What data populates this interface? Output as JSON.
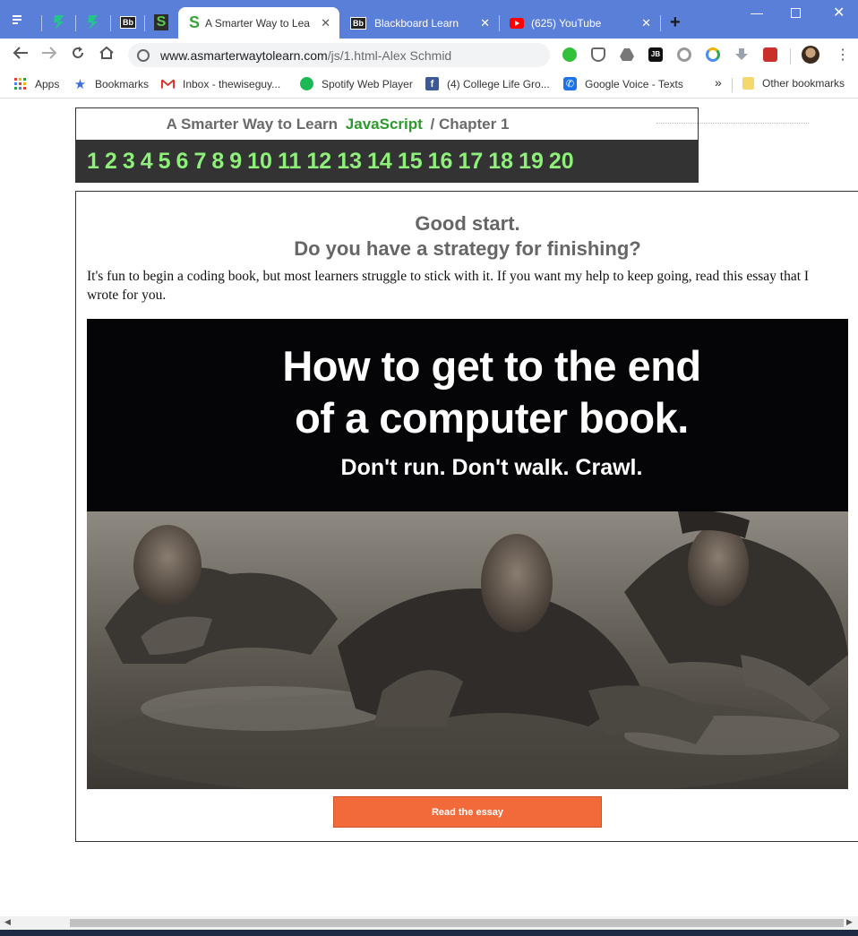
{
  "browser": {
    "tabs": [
      {
        "title": "A Smarter Way to Lea",
        "active": true,
        "favicon": "S"
      },
      {
        "title": "Blackboard Learn",
        "active": false,
        "favicon": "Bb"
      },
      {
        "title": "(625) YouTube",
        "active": false,
        "favicon": "youtube"
      }
    ],
    "pinned_favicons": [
      "zybooks",
      "zybooks",
      "Bb",
      "S"
    ],
    "pinned_bb_label": "Bb",
    "pinned_s_label": "S",
    "new_tab": "+",
    "address": {
      "host": "www.asmarterwaytolearn.com",
      "path": "/js/1.html-Alex Schmid"
    },
    "bookmarks": [
      {
        "label": "Apps",
        "icon": "apps-grid-icon"
      },
      {
        "label": "Bookmarks",
        "icon": "star-icon"
      },
      {
        "label": "Inbox - thewiseguy...",
        "icon": "gmail-icon"
      },
      {
        "label": "Spotify Web Player",
        "icon": "spotify-icon"
      },
      {
        "label": "(4) College Life Gro...",
        "icon": "facebook-icon"
      },
      {
        "label": "Google Voice - Texts",
        "icon": "google-voice-icon"
      }
    ],
    "bookmarks_overflow": "»",
    "other_bookmarks": "Other bookmarks"
  },
  "page": {
    "book_title_pre": "A Smarter Way to Learn",
    "book_title_lang": "JavaScript",
    "book_title_sep": "/",
    "book_title_chapter": "Chapter 1",
    "chapters": [
      "1",
      "2",
      "3",
      "4",
      "5",
      "6",
      "7",
      "8",
      "9",
      "10",
      "11",
      "12",
      "13",
      "14",
      "15",
      "16",
      "17",
      "18",
      "19",
      "20"
    ],
    "headline_1": "Good start.",
    "headline_2": "Do you have a strategy for finishing?",
    "intro": "It's fun to begin a coding book, but most learners struggle to stick with it. If you want my help to keep going, read this essay that I wrote for you.",
    "banner_line_1": "How to get to the end",
    "banner_line_2": "of a computer book.",
    "banner_sub": "Don't run. Don't walk. Crawl.",
    "cta": "Read the essay"
  },
  "colors": {
    "tabbar": "#5a7fd8",
    "chapter_link": "#8ef07a",
    "lang": "#2b9a2b",
    "cta": "#f26a3a"
  }
}
